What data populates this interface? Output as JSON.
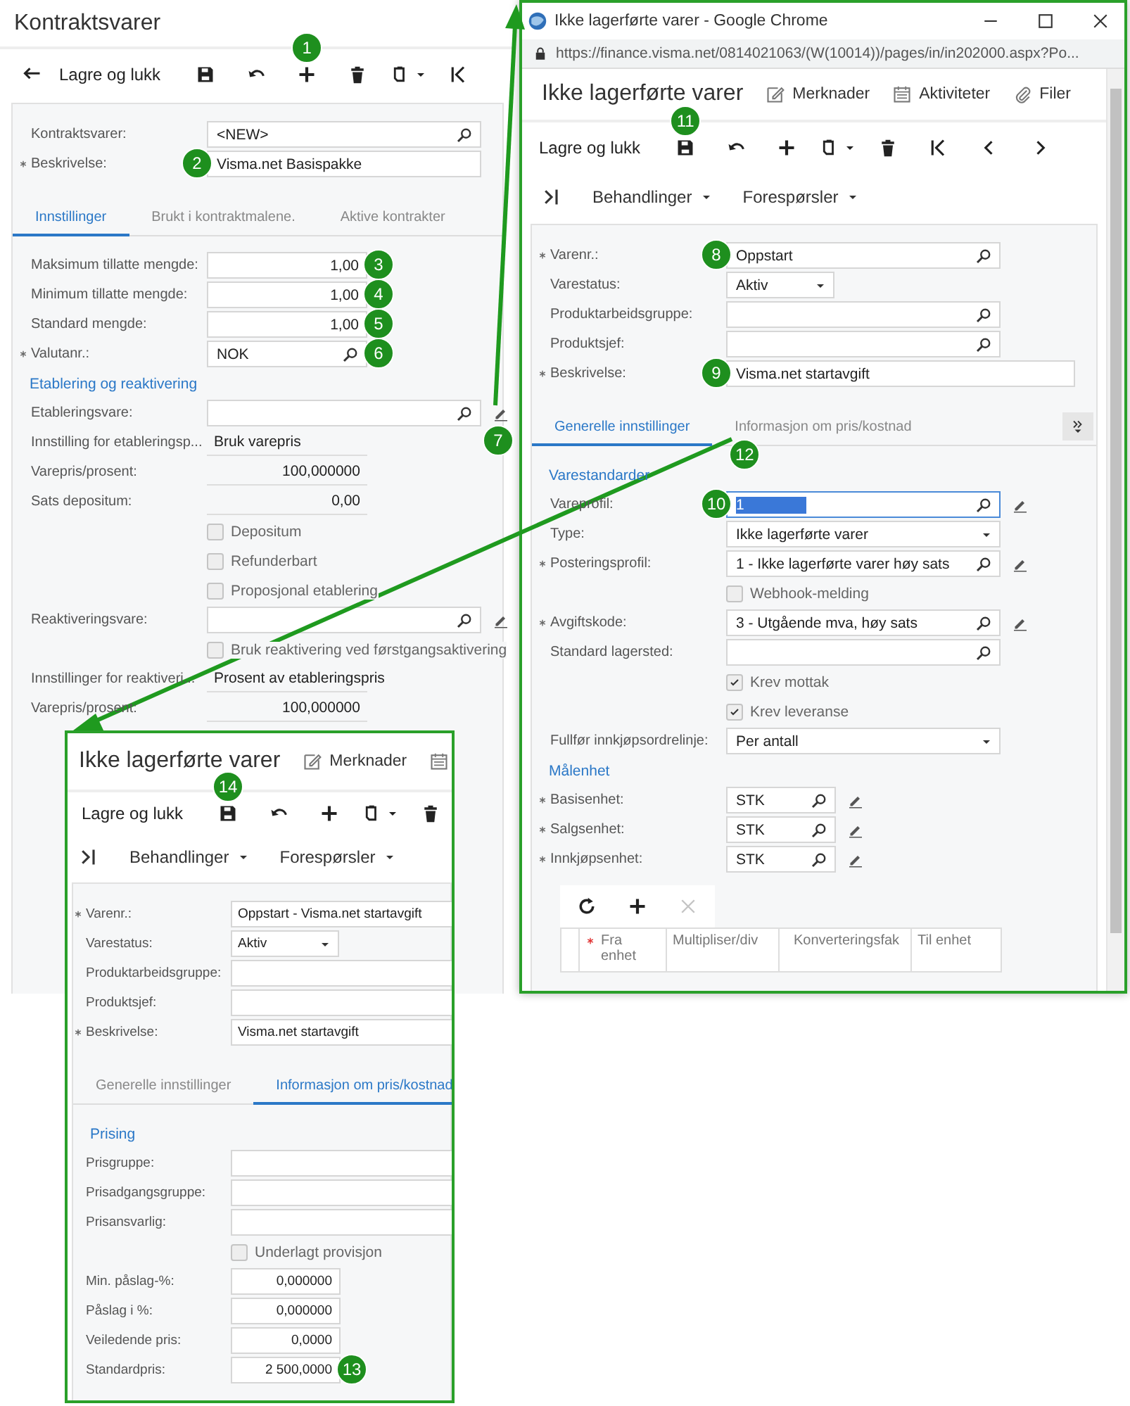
{
  "windows": [
    {
      "title": "Kontraktsvarer",
      "toolbar": [
        {
          "kind": "back"
        },
        {
          "kind": "text",
          "label": "Lagre og lukk"
        },
        {
          "kind": "save"
        },
        {
          "kind": "undo"
        },
        {
          "kind": "add",
          "badge": "1"
        },
        {
          "kind": "delete"
        },
        {
          "kind": "copy"
        },
        {
          "kind": "first"
        }
      ],
      "fields": [
        {
          "kind": "lookup",
          "label": "Kontraktsvarer:",
          "value": "<NEW>"
        },
        {
          "kind": "text",
          "label": "Beskrivelse:",
          "required": true,
          "value": "Visma.net Basispakke",
          "badge": "2"
        }
      ],
      "tabs": [
        {
          "label": "Innstillinger",
          "selected": true
        },
        {
          "label": "Brukt i kontraktmalene.",
          "selected": false
        },
        {
          "label": "Aktive kontrakter",
          "selected": false
        }
      ],
      "rows": [
        {
          "kind": "number",
          "label": "Maksimum tillatte mengde:",
          "value": "1,00",
          "badge": "3"
        },
        {
          "kind": "number",
          "label": "Minimum tillatte mengde:",
          "value": "1,00",
          "badge": "4"
        },
        {
          "kind": "number",
          "label": "Standard mengde:",
          "value": "1,00",
          "badge": "5"
        },
        {
          "kind": "short-lookup",
          "label": "Valutanr.:",
          "required": true,
          "value": "NOK",
          "badge": "6"
        },
        {
          "kind": "section",
          "label": "Etablering og reaktivering"
        },
        {
          "kind": "lookup",
          "label": "Etableringsvare:",
          "edit": true,
          "badge": "7"
        },
        {
          "kind": "readonly",
          "label": "Innstilling for etableringsp...",
          "value": "Bruk varepris"
        },
        {
          "kind": "readonly-number",
          "label": "Varepris/prosent:",
          "value": "100,000000"
        },
        {
          "kind": "readonly-number",
          "label": "Sats depositum:",
          "value": "0,00"
        },
        {
          "kind": "checkbox",
          "label": "Depositum",
          "checked": false
        },
        {
          "kind": "checkbox",
          "label": "Refunderbart",
          "checked": false
        },
        {
          "kind": "checkbox",
          "label": "Proposjonal etablering",
          "checked": false
        },
        {
          "kind": "lookup",
          "label": "Reaktiveringsvare:",
          "edit": true
        },
        {
          "kind": "checkbox",
          "label": "Bruk reaktivering ved førstgangsaktivering",
          "checked": false
        },
        {
          "kind": "readonly",
          "label": "Innstillinger for reaktiveri...",
          "value": "Prosent av etableringspris"
        },
        {
          "kind": "readonly-number",
          "label": "Varepris/prosent:",
          "value": "100,000000"
        }
      ]
    },
    {
      "browser": {
        "title": "Ikke lagerførte varer - Google Chrome",
        "url": "https://finance.visma.net/0814021063/(W(10014))/pages/in/in202000.aspx?Po..."
      },
      "title": "Ikke lagerførte varer",
      "actions": [
        {
          "kind": "note",
          "label": "Merknader"
        },
        {
          "kind": "calendar",
          "label": "Aktiviteter"
        },
        {
          "kind": "attach",
          "label": "Filer"
        }
      ],
      "toolbar": [
        {
          "kind": "text",
          "label": "Lagre og lukk"
        },
        {
          "kind": "save",
          "badge": "11"
        },
        {
          "kind": "undo"
        },
        {
          "kind": "add"
        },
        {
          "kind": "copy"
        },
        {
          "kind": "delete"
        },
        {
          "kind": "first"
        },
        {
          "kind": "prev"
        },
        {
          "kind": "next"
        }
      ],
      "menus": [
        {
          "kind": "pin"
        },
        {
          "kind": "menu",
          "label": "Behandlinger"
        },
        {
          "kind": "menu",
          "label": "Forespørsler"
        }
      ],
      "fields": [
        {
          "kind": "lookup",
          "label": "Varenr.:",
          "required": true,
          "value": "Oppstart",
          "badge": "8"
        },
        {
          "kind": "short-select",
          "label": "Varestatus:",
          "value": "Aktiv"
        },
        {
          "kind": "lookup",
          "label": "Produktarbeidsgruppe:"
        },
        {
          "kind": "lookup",
          "label": "Produktsjef:"
        },
        {
          "kind": "text",
          "label": "Beskrivelse:",
          "required": true,
          "value": "Visma.net startavgift",
          "badge": "9"
        }
      ],
      "tabs": [
        {
          "label": "Generelle innstillinger",
          "selected": true
        },
        {
          "label": "Informasjon om pris/kostnad",
          "selected": false,
          "badge": "12"
        }
      ],
      "tab_overflow": true,
      "rows": [
        {
          "kind": "section",
          "label": "Varestandarder"
        },
        {
          "kind": "lookup",
          "label": "Vareprofil:",
          "value": "1",
          "text_selected": true,
          "edit": true,
          "badge": "10"
        },
        {
          "kind": "select",
          "label": "Type:",
          "value": "Ikke lagerførte varer"
        },
        {
          "kind": "lookup",
          "label": "Posteringsprofil:",
          "required": true,
          "value": "1 - Ikke lagerførte varer høy sats",
          "edit": true
        },
        {
          "kind": "checkbox",
          "label": "Webhook-melding",
          "checked": false
        },
        {
          "kind": "lookup",
          "label": "Avgiftskode:",
          "required": true,
          "value": "3 - Utgående mva, høy sats",
          "edit": true
        },
        {
          "kind": "lookup",
          "label": "Standard lagersted:"
        },
        {
          "kind": "checkbox",
          "label": "Krev mottak",
          "checked": true
        },
        {
          "kind": "checkbox",
          "label": "Krev leveranse",
          "checked": true
        },
        {
          "kind": "select",
          "label": "Fullfør innkjøpsordrelinje:",
          "value": "Per antall"
        },
        {
          "kind": "section",
          "label": "Målenhet"
        },
        {
          "kind": "unit-lookup",
          "label": "Basisenhet:",
          "required": true,
          "value": "STK",
          "edit": true
        },
        {
          "kind": "unit-lookup",
          "label": "Salgsenhet:",
          "required": true,
          "value": "STK",
          "edit": true
        },
        {
          "kind": "unit-lookup",
          "label": "Innkjøpsenhet:",
          "required": true,
          "value": "STK",
          "edit": true
        }
      ],
      "grid": {
        "toolbar": [
          {
            "kind": "refresh",
            "disabled": false
          },
          {
            "kind": "add",
            "disabled": false
          },
          {
            "kind": "remove",
            "disabled": true
          }
        ],
        "columns": [
          {
            "label": "Fra enhet",
            "required": true
          },
          {
            "label": "Multipliser/div"
          },
          {
            "label": "Konverteringsfak"
          },
          {
            "label": "Til enhet"
          }
        ]
      }
    },
    {
      "title": "Ikke lagerførte varer",
      "actions": [
        {
          "kind": "note",
          "label": "Merknader"
        },
        {
          "kind": "calendar"
        }
      ],
      "toolbar": [
        {
          "kind": "text",
          "label": "Lagre og lukk"
        },
        {
          "kind": "save",
          "badge": "14"
        },
        {
          "kind": "undo"
        },
        {
          "kind": "add"
        },
        {
          "kind": "copy"
        },
        {
          "kind": "delete"
        }
      ],
      "menus": [
        {
          "kind": "pin"
        },
        {
          "kind": "menu",
          "label": "Behandlinger"
        },
        {
          "kind": "menu",
          "label": "Forespørsler"
        }
      ],
      "fields": [
        {
          "kind": "text",
          "label": "Varenr.:",
          "required": true,
          "value": "Oppstart - Visma.net startavgift"
        },
        {
          "kind": "short-select",
          "label": "Varestatus:",
          "value": "Aktiv"
        },
        {
          "kind": "text",
          "label": "Produktarbeidsgruppe:"
        },
        {
          "kind": "text",
          "label": "Produktsjef:"
        },
        {
          "kind": "text",
          "label": "Beskrivelse:",
          "required": true,
          "value": "Visma.net startavgift"
        }
      ],
      "tabs": [
        {
          "label": "Generelle innstillinger",
          "selected": false
        },
        {
          "label": "Informasjon om pris/kostnad",
          "selected": true
        }
      ],
      "rows": [
        {
          "kind": "section",
          "label": "Prising"
        },
        {
          "kind": "text",
          "label": "Prisgruppe:"
        },
        {
          "kind": "text",
          "label": "Prisadgangsgruppe:"
        },
        {
          "kind": "text",
          "label": "Prisansvarlig:"
        },
        {
          "kind": "checkbox",
          "label": "Underlagt provisjon",
          "checked": false
        },
        {
          "kind": "number",
          "label": "Min. påslag-%:",
          "value": "0,000000"
        },
        {
          "kind": "number",
          "label": "Påslag i %:",
          "value": "0,000000"
        },
        {
          "kind": "number",
          "label": "Veiledende pris:",
          "value": "0,0000"
        },
        {
          "kind": "number",
          "label": "Standardpris:",
          "value": "2 500,0000",
          "badge": "13"
        }
      ]
    }
  ]
}
